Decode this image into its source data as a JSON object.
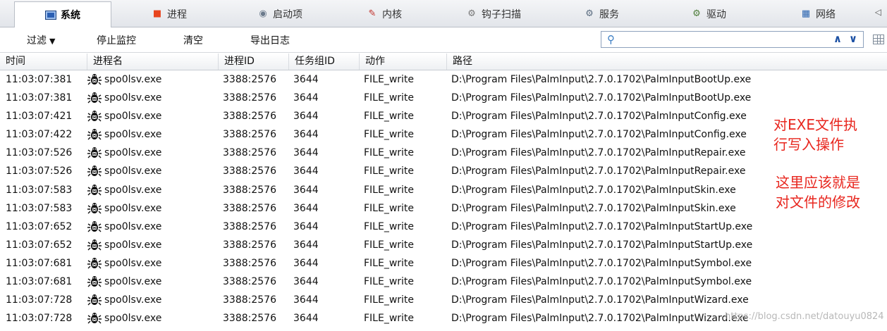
{
  "tabs": [
    {
      "label": "系统",
      "icon": "system-icon"
    },
    {
      "label": "进程",
      "icon": "process-icon"
    },
    {
      "label": "启动项",
      "icon": "startup-icon"
    },
    {
      "label": "内核",
      "icon": "kernel-icon"
    },
    {
      "label": "钩子扫描",
      "icon": "hook-scan-icon"
    },
    {
      "label": "服务",
      "icon": "service-icon"
    },
    {
      "label": "驱动",
      "icon": "driver-icon"
    },
    {
      "label": "网络",
      "icon": "network-icon"
    }
  ],
  "toolbar": {
    "filter_label": "过滤",
    "stop_label": "停止监控",
    "clear_label": "清空",
    "export_label": "导出日志",
    "search_value": ""
  },
  "columns": [
    "时间",
    "进程名",
    "进程ID",
    "任务组ID",
    "动作",
    "路径"
  ],
  "rows": [
    {
      "time": "11:03:07:381",
      "proc": "spo0lsv.exe",
      "pid": "3388:2576",
      "tgid": "3644",
      "action": "FILE_write",
      "path": "D:\\Program Files\\PalmInput\\2.7.0.1702\\PalmInputBootUp.exe"
    },
    {
      "time": "11:03:07:381",
      "proc": "spo0lsv.exe",
      "pid": "3388:2576",
      "tgid": "3644",
      "action": "FILE_write",
      "path": "D:\\Program Files\\PalmInput\\2.7.0.1702\\PalmInputBootUp.exe"
    },
    {
      "time": "11:03:07:421",
      "proc": "spo0lsv.exe",
      "pid": "3388:2576",
      "tgid": "3644",
      "action": "FILE_write",
      "path": "D:\\Program Files\\PalmInput\\2.7.0.1702\\PalmInputConfig.exe"
    },
    {
      "time": "11:03:07:422",
      "proc": "spo0lsv.exe",
      "pid": "3388:2576",
      "tgid": "3644",
      "action": "FILE_write",
      "path": "D:\\Program Files\\PalmInput\\2.7.0.1702\\PalmInputConfig.exe"
    },
    {
      "time": "11:03:07:526",
      "proc": "spo0lsv.exe",
      "pid": "3388:2576",
      "tgid": "3644",
      "action": "FILE_write",
      "path": "D:\\Program Files\\PalmInput\\2.7.0.1702\\PalmInputRepair.exe"
    },
    {
      "time": "11:03:07:526",
      "proc": "spo0lsv.exe",
      "pid": "3388:2576",
      "tgid": "3644",
      "action": "FILE_write",
      "path": "D:\\Program Files\\PalmInput\\2.7.0.1702\\PalmInputRepair.exe"
    },
    {
      "time": "11:03:07:583",
      "proc": "spo0lsv.exe",
      "pid": "3388:2576",
      "tgid": "3644",
      "action": "FILE_write",
      "path": "D:\\Program Files\\PalmInput\\2.7.0.1702\\PalmInputSkin.exe"
    },
    {
      "time": "11:03:07:583",
      "proc": "spo0lsv.exe",
      "pid": "3388:2576",
      "tgid": "3644",
      "action": "FILE_write",
      "path": "D:\\Program Files\\PalmInput\\2.7.0.1702\\PalmInputSkin.exe"
    },
    {
      "time": "11:03:07:652",
      "proc": "spo0lsv.exe",
      "pid": "3388:2576",
      "tgid": "3644",
      "action": "FILE_write",
      "path": "D:\\Program Files\\PalmInput\\2.7.0.1702\\PalmInputStartUp.exe"
    },
    {
      "time": "11:03:07:652",
      "proc": "spo0lsv.exe",
      "pid": "3388:2576",
      "tgid": "3644",
      "action": "FILE_write",
      "path": "D:\\Program Files\\PalmInput\\2.7.0.1702\\PalmInputStartUp.exe"
    },
    {
      "time": "11:03:07:681",
      "proc": "spo0lsv.exe",
      "pid": "3388:2576",
      "tgid": "3644",
      "action": "FILE_write",
      "path": "D:\\Program Files\\PalmInput\\2.7.0.1702\\PalmInputSymbol.exe"
    },
    {
      "time": "11:03:07:681",
      "proc": "spo0lsv.exe",
      "pid": "3388:2576",
      "tgid": "3644",
      "action": "FILE_write",
      "path": "D:\\Program Files\\PalmInput\\2.7.0.1702\\PalmInputSymbol.exe"
    },
    {
      "time": "11:03:07:728",
      "proc": "spo0lsv.exe",
      "pid": "3388:2576",
      "tgid": "3644",
      "action": "FILE_write",
      "path": "D:\\Program Files\\PalmInput\\2.7.0.1702\\PalmInputWizard.exe"
    },
    {
      "time": "11:03:07:728",
      "proc": "spo0lsv.exe",
      "pid": "3388:2576",
      "tgid": "3644",
      "action": "FILE_write",
      "path": "D:\\Program Files\\PalmInput\\2.7.0.1702\\PalmInputWizard.exe"
    }
  ],
  "annotation": {
    "line1": "对EXE文件执",
    "line2": "行写入操作",
    "line3": "这里应该就是",
    "line4": "对文件的修改"
  },
  "watermark": "https://blog.csdn.net/datouyu0824"
}
